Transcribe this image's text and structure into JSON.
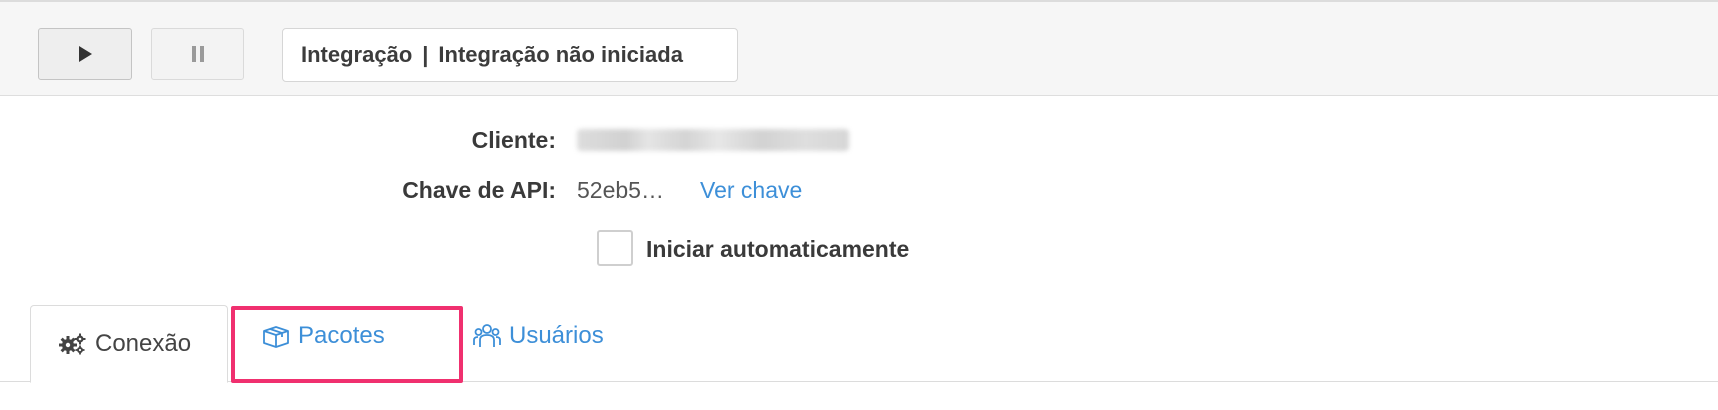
{
  "toolbar": {
    "play_icon": "play-icon",
    "pause_icon": "pause-icon",
    "status": {
      "label": "Integração",
      "separator": "|",
      "value": "Integração não iniciada"
    }
  },
  "details": {
    "client_label": "Cliente:",
    "client_value_blurred": true,
    "api_key_label": "Chave de API:",
    "api_key_value": "52eb5…",
    "view_key_link": "Ver chave"
  },
  "auto_start": {
    "label": "Iniciar automaticamente",
    "checked": false
  },
  "tabs": [
    {
      "label": "Conexão",
      "icon": "gears-icon",
      "active": true
    },
    {
      "label": "Pacotes",
      "icon": "package-icon",
      "active": false,
      "highlighted": true
    },
    {
      "label": "Usuários",
      "icon": "users-icon",
      "active": false
    }
  ],
  "colors": {
    "link": "#3d8fd8",
    "highlight": "#f0306f",
    "toolbar_bg": "#f6f6f6"
  }
}
